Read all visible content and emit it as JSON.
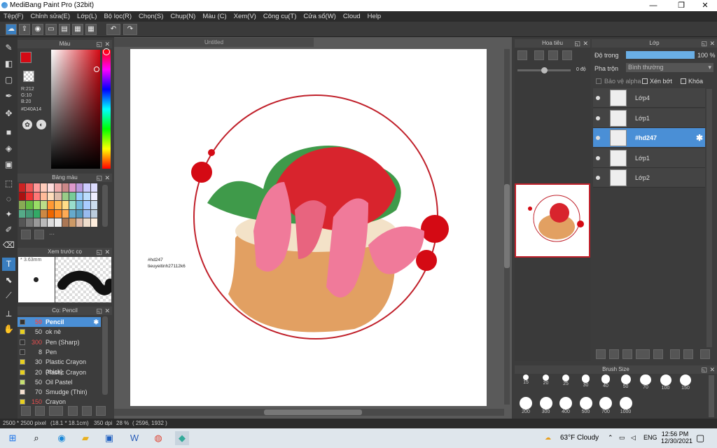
{
  "window": {
    "title": "MediBang Paint Pro (32bit)",
    "minimize": "—",
    "restore": "❐",
    "close": "✕"
  },
  "menu": [
    "Tệp(F)",
    "Chỉnh sửa(E)",
    "Lớp(L)",
    "Bộ lọc(R)",
    "Chọn(S)",
    "Chụp(N)",
    "Màu (C)",
    "Xem(V)",
    "Công cụ(T)",
    "Cửa sổ(W)",
    "Cloud",
    "Help"
  ],
  "color_panel": {
    "title": "Màu",
    "r": "R:212",
    "g": "G:10",
    "b": "B:20",
    "hex": "#D40A14",
    "primary": "#D40A14"
  },
  "palette_panel": {
    "title": "Bảng màu",
    "dots": "···"
  },
  "preview_panel": {
    "title": "Xem trước cọ",
    "size": "3.63mm"
  },
  "brush_panel": {
    "title": "Cọ: Pencil",
    "items": [
      {
        "size": "50",
        "name": "Pencil",
        "sel": true,
        "color": "#333"
      },
      {
        "size": "50",
        "name": "ok nè",
        "sel": false,
        "color": "#e8d020"
      },
      {
        "size": "300",
        "name": "Pen (Sharp)",
        "sel": false,
        "color": "#333"
      },
      {
        "size": "8",
        "name": "Pen",
        "sel": false,
        "color": "#333"
      },
      {
        "size": "30",
        "name": "Plastic Crayon (thick)",
        "sel": false,
        "color": "#e8d020"
      },
      {
        "size": "20",
        "name": "Plastic Crayon",
        "sel": false,
        "color": "#e8d020"
      },
      {
        "size": "50",
        "name": "Oil Pastel",
        "sel": false,
        "color": "#c8e070"
      },
      {
        "size": "70",
        "name": "Smudge (Thin)",
        "sel": false,
        "color": "#f5e0d0"
      },
      {
        "size": "150",
        "name": "Crayon",
        "sel": false,
        "color": "#e8d020"
      }
    ]
  },
  "canvas": {
    "tab": "Untitled",
    "watermark1": "#hd247",
    "watermark2": "tieuyeitinh27112k6"
  },
  "navigator": {
    "title": "Hoa tiêu",
    "angle": "0 độ"
  },
  "layers_panel": {
    "title": "Lớp",
    "opacity_label": "Độ trong",
    "opacity_value": "100 %",
    "opacity": 1.0,
    "blend_label": "Pha trộn",
    "blend_value": "Bình thường",
    "protect_alpha": "Bảo vệ alpha",
    "clipping": "Xén bớt",
    "lock": "Khóa",
    "layers": [
      {
        "name": "Lớp4",
        "sel": false
      },
      {
        "name": "Lớp1",
        "sel": false
      },
      {
        "name": "#hd247",
        "sel": true
      },
      {
        "name": "Lớp1",
        "sel": false
      },
      {
        "name": "Lớp2",
        "sel": false
      }
    ]
  },
  "brush_size_panel": {
    "title": "Brush Size",
    "sizes": [
      "15",
      "20",
      "25",
      "30",
      "40",
      "50",
      "70",
      "100",
      "150",
      "200",
      "300",
      "400",
      "500",
      "700",
      "1000"
    ]
  },
  "status": {
    "dimensions": "2500 * 2500 pixel",
    "physical": "(18.1 * 18.1cm)",
    "dpi": "350 dpi",
    "zoom": "28 %",
    "coords": "( 2596, 1932 )"
  },
  "taskbar": {
    "weather": "63°F  Cloudy",
    "lang": "ENG",
    "time": "12:56 PM",
    "date": "12/30/2021"
  }
}
